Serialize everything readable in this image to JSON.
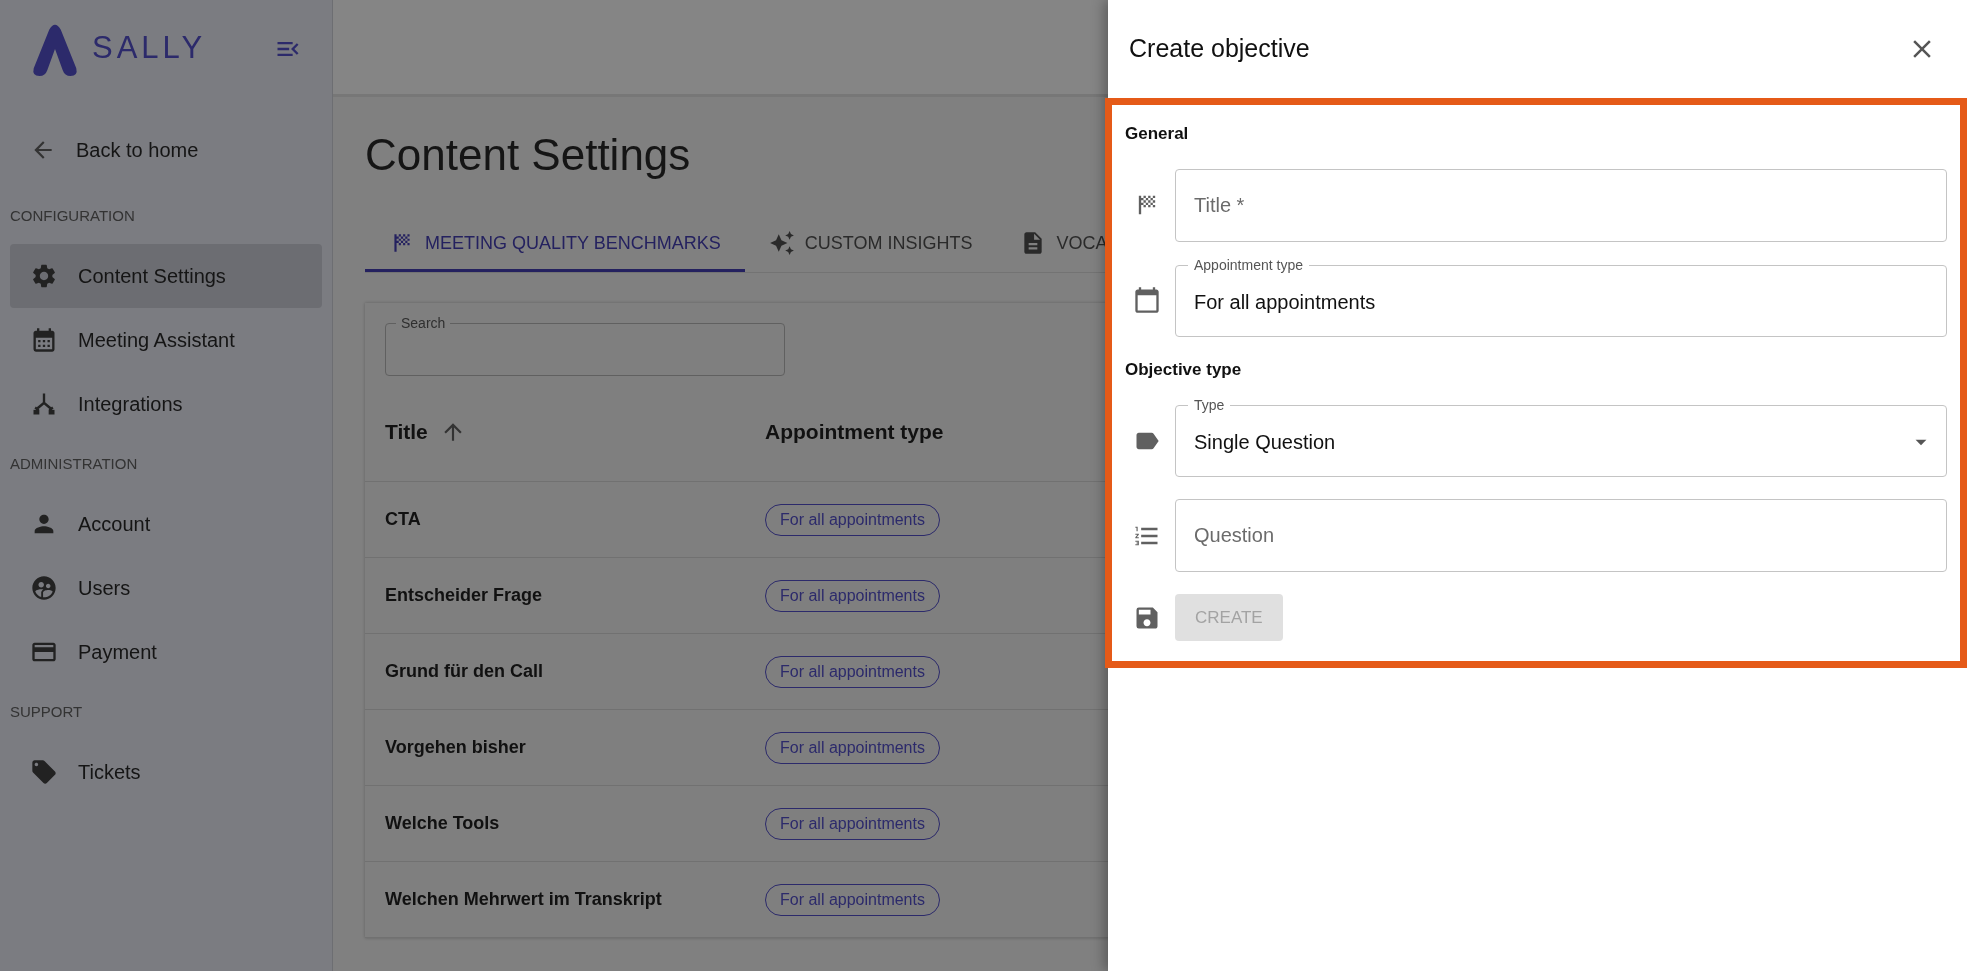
{
  "sidebar": {
    "logo_text": "SALLY",
    "back_link": "Back to home",
    "sections": [
      {
        "heading": "CONFIGURATION",
        "items": [
          {
            "label": "Content Settings",
            "selected": true
          },
          {
            "label": "Meeting Assistant",
            "selected": false
          },
          {
            "label": "Integrations",
            "selected": false
          }
        ]
      },
      {
        "heading": "ADMINISTRATION",
        "items": [
          {
            "label": "Account",
            "selected": false
          },
          {
            "label": "Users",
            "selected": false
          },
          {
            "label": "Payment",
            "selected": false
          }
        ]
      },
      {
        "heading": "SUPPORT",
        "items": [
          {
            "label": "Tickets",
            "selected": false
          }
        ]
      }
    ]
  },
  "page": {
    "title": "Content Settings",
    "tabs": [
      {
        "label": "MEETING QUALITY BENCHMARKS",
        "selected": true
      },
      {
        "label": "CUSTOM INSIGHTS",
        "selected": false
      },
      {
        "label": "VOCA",
        "selected": false
      }
    ],
    "search": {
      "label": "Search"
    },
    "table": {
      "columns": [
        {
          "label": "Title",
          "sorted": true
        },
        {
          "label": "Appointment type",
          "sorted": false
        }
      ],
      "rows": [
        {
          "title": "CTA",
          "appointment_type": "For all appointments"
        },
        {
          "title": "Entscheider Frage",
          "appointment_type": "For all appointments"
        },
        {
          "title": "Grund für den Call",
          "appointment_type": "For all appointments"
        },
        {
          "title": "Vorgehen bisher",
          "appointment_type": "For all appointments"
        },
        {
          "title": "Welche Tools",
          "appointment_type": "For all appointments"
        },
        {
          "title": "Welchen Mehrwert im Transkript",
          "appointment_type": "For all appointments"
        }
      ]
    }
  },
  "drawer": {
    "title": "Create objective",
    "sections": [
      {
        "heading": "General",
        "fields": [
          {
            "kind": "input",
            "placeholder": "Title *"
          },
          {
            "kind": "value",
            "label": "Appointment type",
            "value": "For all appointments"
          }
        ]
      },
      {
        "heading": "Objective type",
        "fields": [
          {
            "kind": "select",
            "label": "Type",
            "value": "Single Question"
          },
          {
            "kind": "input",
            "placeholder": "Question"
          }
        ]
      }
    ],
    "button": {
      "label": "CREATE",
      "disabled": true
    }
  }
}
